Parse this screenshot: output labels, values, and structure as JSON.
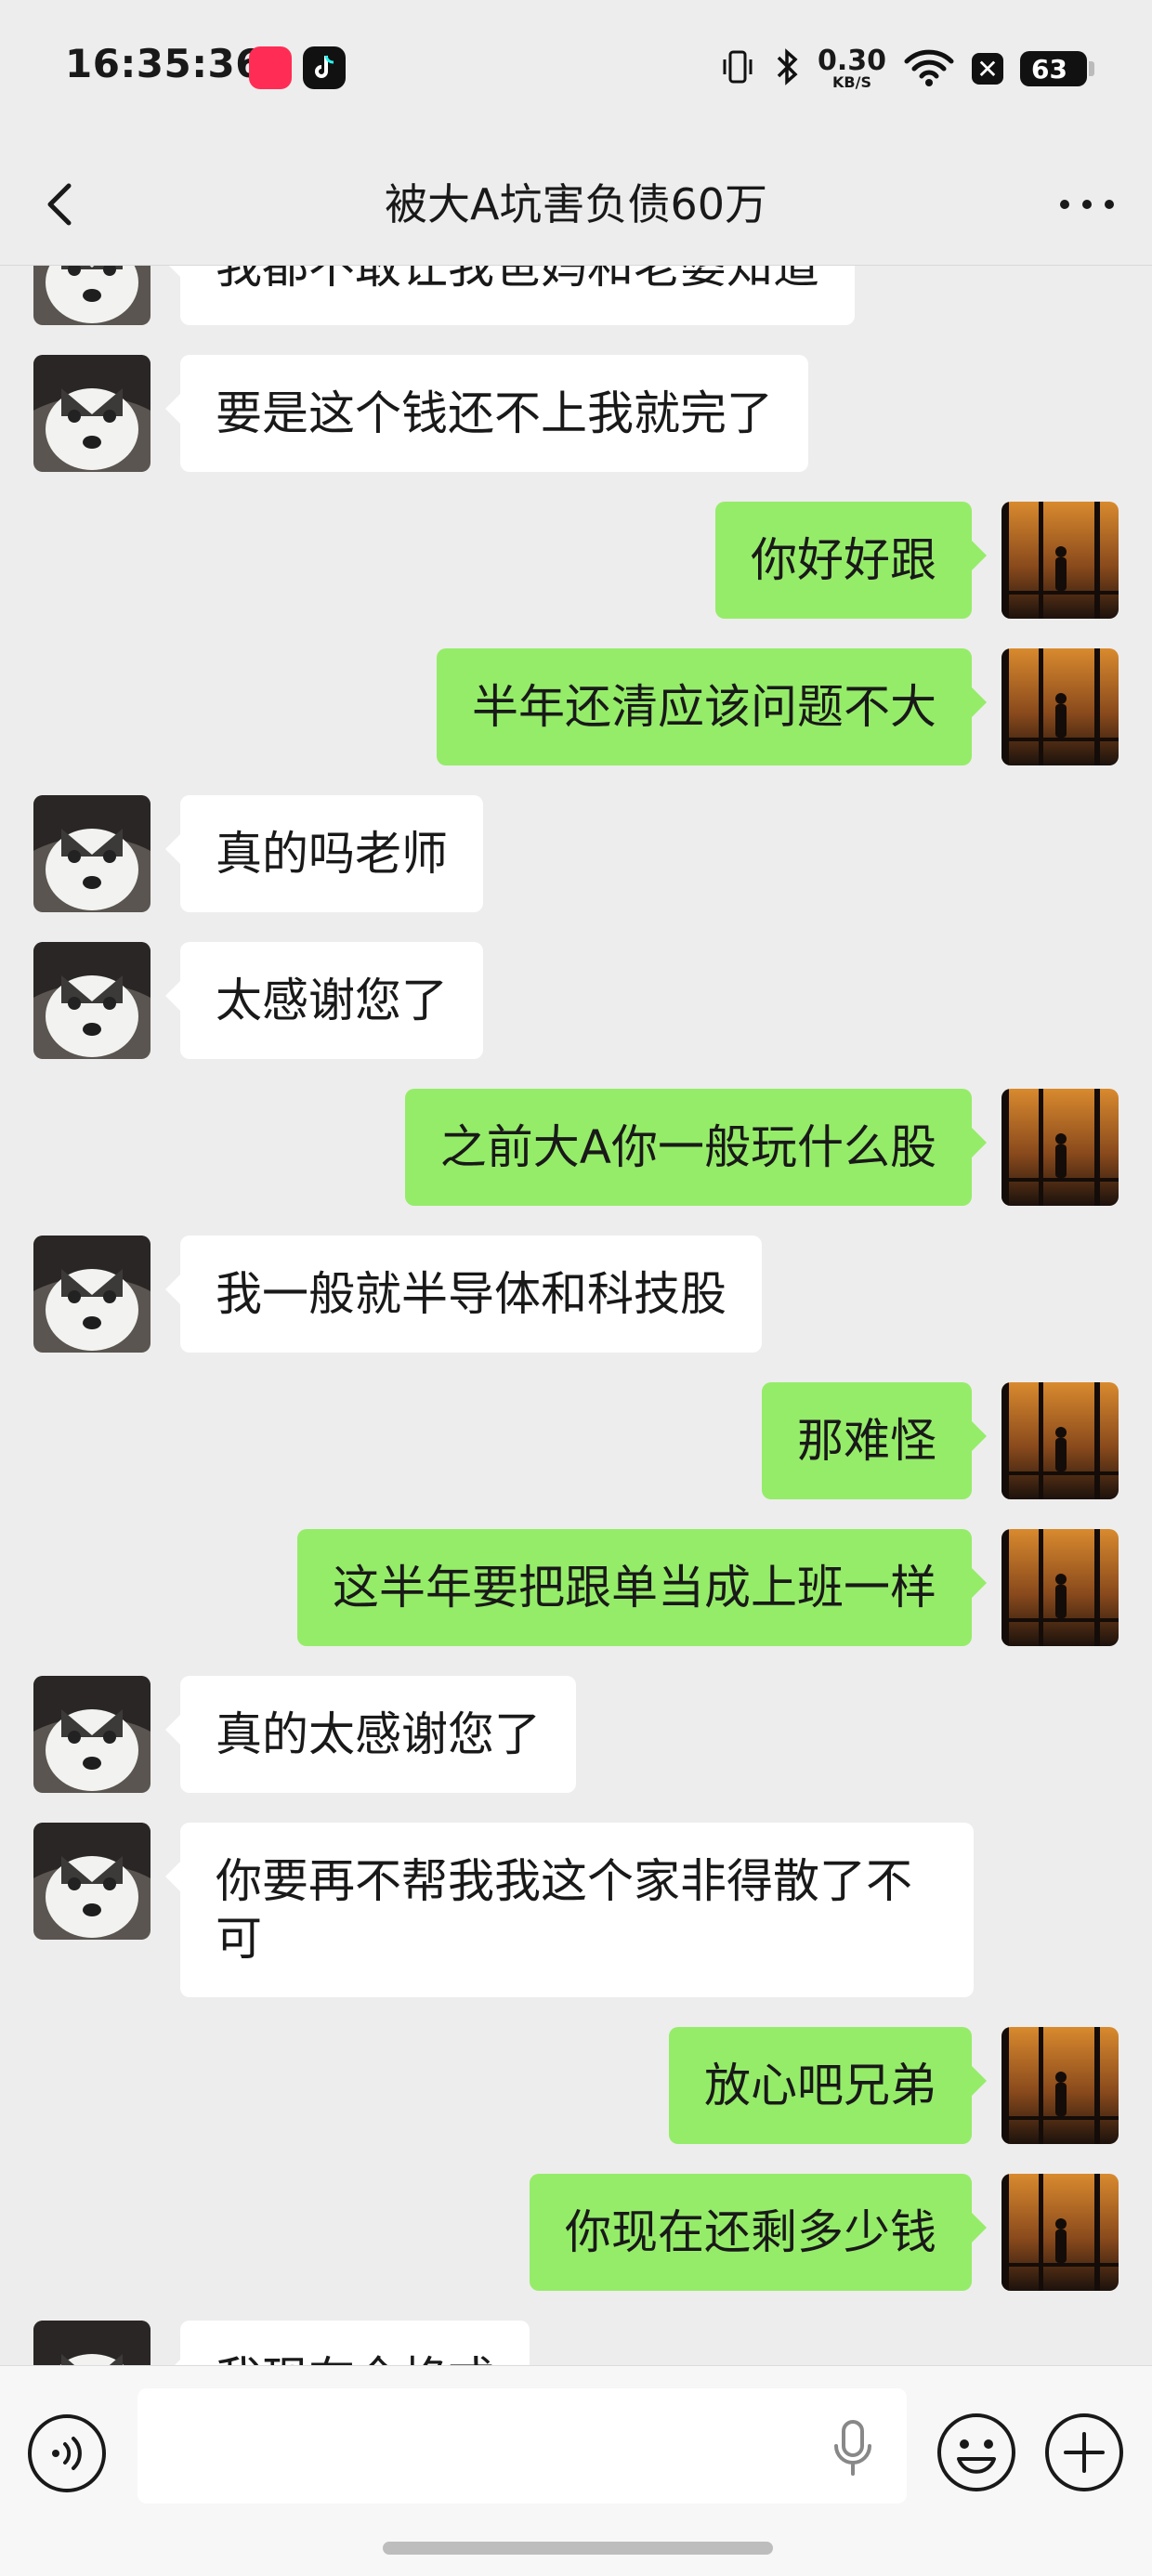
{
  "status_bar": {
    "time": "16:35:36",
    "app1_label": "",
    "net_speed_value": "0.30",
    "net_speed_unit": "KB/S",
    "battery": "63"
  },
  "nav": {
    "title": "被大A坑害负债60万"
  },
  "messages": [
    {
      "side": "left",
      "text": "我都不敢让我爸妈和老婆知道"
    },
    {
      "side": "left",
      "text": "要是这个钱还不上我就完了"
    },
    {
      "side": "right",
      "text": "你好好跟"
    },
    {
      "side": "right",
      "text": "半年还清应该问题不大"
    },
    {
      "side": "left",
      "text": "真的吗老师"
    },
    {
      "side": "left",
      "text": "太感谢您了"
    },
    {
      "side": "right",
      "text": "之前大A你一般玩什么股"
    },
    {
      "side": "left",
      "text": "我一般就半导体和科技股"
    },
    {
      "side": "right",
      "text": "那难怪"
    },
    {
      "side": "right",
      "text": "这半年要把跟单当成上班一样"
    },
    {
      "side": "left",
      "text": "真的太感谢您了"
    },
    {
      "side": "left",
      "text": "你要再不帮我我这个家非得散了不可"
    },
    {
      "side": "right",
      "text": "放心吧兄弟"
    },
    {
      "side": "right",
      "text": "你现在还剩多少钱"
    },
    {
      "side": "left",
      "text": "我现在全格式"
    }
  ],
  "input": {
    "value": "",
    "placeholder": ""
  },
  "colors": {
    "background": "#ededed",
    "sent_bubble": "#95ec69",
    "received_bubble": "#ffffff"
  },
  "icons": {
    "back": "chevron-left-icon",
    "more": "more-dots-icon",
    "voice": "voice-mode-icon",
    "mic": "microphone-icon",
    "emoji": "emoji-smile-icon",
    "plus": "plus-circle-icon"
  }
}
